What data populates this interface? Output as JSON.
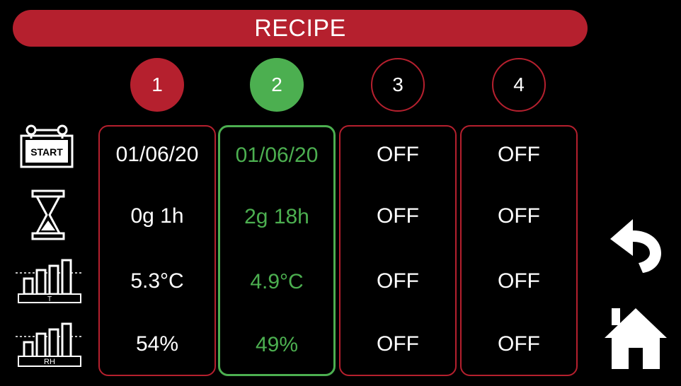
{
  "header": {
    "title": "RECIPE"
  },
  "row_icons": [
    {
      "name": "calendar-start-icon",
      "label": "START"
    },
    {
      "name": "hourglass-icon"
    },
    {
      "name": "temperature-chart-icon",
      "label": "T"
    },
    {
      "name": "humidity-chart-icon",
      "label": "RH"
    }
  ],
  "recipes": [
    {
      "number": "1",
      "date": "01/06/20",
      "duration": "0g 1h",
      "temperature": "5.3°C",
      "humidity": "54%"
    },
    {
      "number": "2",
      "date": "01/06/20",
      "duration": "2g 18h",
      "temperature": "4.9°C",
      "humidity": "49%"
    },
    {
      "number": "3",
      "date": "OFF",
      "duration": "OFF",
      "temperature": "OFF",
      "humidity": "OFF"
    },
    {
      "number": "4",
      "date": "OFF",
      "duration": "OFF",
      "temperature": "OFF",
      "humidity": "OFF"
    }
  ],
  "colors": {
    "red": "#b5202e",
    "green": "#4caf50",
    "background": "#000000"
  },
  "nav": [
    {
      "name": "back-arrow-icon"
    },
    {
      "name": "home-icon"
    }
  ]
}
